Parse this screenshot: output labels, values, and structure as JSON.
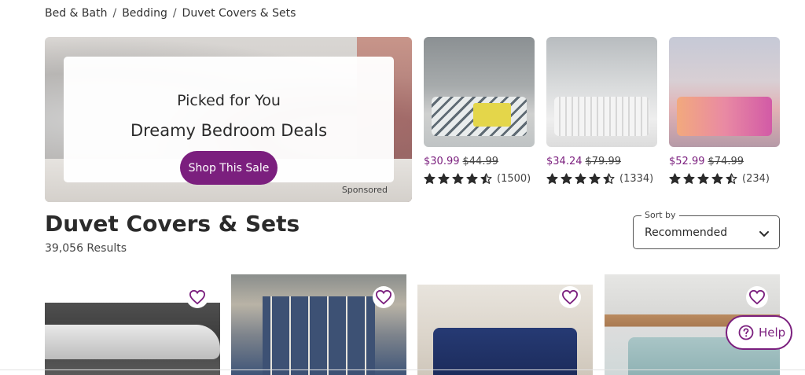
{
  "breadcrumb": [
    {
      "label": "Bed & Bath"
    },
    {
      "label": "Bedding"
    },
    {
      "label": "Duvet Covers & Sets"
    }
  ],
  "breadcrumb_separator": "/",
  "hero": {
    "kicker": "Picked for You",
    "title": "Dreamy Bedroom Deals",
    "cta_label": "Shop This Sale",
    "sponsored_label": "Sponsored"
  },
  "recommended": [
    {
      "price": "$30.99",
      "was_price": "$44.99",
      "rating": 4.5,
      "reviews": "(1500)"
    },
    {
      "price": "$34.24",
      "was_price": "$79.99",
      "rating": 4.5,
      "reviews": "(1334)"
    },
    {
      "price": "$52.99",
      "was_price": "$74.99",
      "rating": 4.5,
      "reviews": "(234)"
    }
  ],
  "page": {
    "title": "Duvet Covers & Sets",
    "results": "39,056 Results"
  },
  "sort": {
    "legend": "Sort by",
    "value": "Recommended"
  },
  "help": {
    "label": "Help"
  },
  "colors": {
    "brand": "#7b1f7e",
    "text": "#2b2b2b"
  }
}
